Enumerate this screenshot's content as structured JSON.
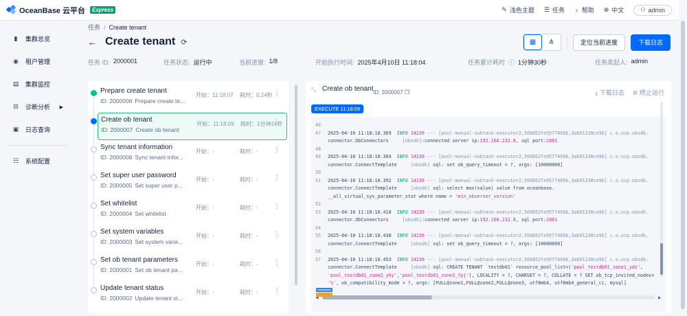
{
  "app": {
    "name": "OceanBase 云平台",
    "edition": "Express"
  },
  "topbar": {
    "items": [
      {
        "icon": "paint-brush-icon",
        "label": "浅色主题"
      },
      {
        "icon": "list-icon",
        "label": "任务"
      },
      {
        "icon": "lightbulb-icon",
        "label": "帮助"
      },
      {
        "icon": "globe-icon",
        "label": "中文"
      }
    ],
    "user": "admin"
  },
  "sidebar": {
    "items": [
      {
        "icon": "bar-chart-icon",
        "label": "集群总览"
      },
      {
        "icon": "tenant-icon",
        "label": "租户管理"
      },
      {
        "icon": "monitor-icon",
        "label": "集群监控"
      },
      {
        "icon": "diagnosis-icon",
        "label": "诊断分析",
        "has_submenu": true
      },
      {
        "icon": "log-icon",
        "label": "日志查询"
      }
    ],
    "bottom_items": [
      {
        "icon": "sliders-icon",
        "label": "系统配置"
      }
    ]
  },
  "breadcrumb": {
    "parent": "任务",
    "current": "Create tenant"
  },
  "page": {
    "title": "Create tenant"
  },
  "actions": {
    "locate": "定位当前进度",
    "download": "下载日志"
  },
  "meta": {
    "task_id_label": "任务 ID:",
    "task_id": "2000001",
    "status_label": "任务状态:",
    "status": "运行中",
    "progress_label": "当前进度:",
    "progress": "1/8",
    "start_label": "开始执行时间:",
    "start": "2025年4月10日 11:18:04",
    "elapsed_label": "任务累计耗时",
    "elapsed": "1分钟30秒",
    "initiator_label": "任务发起人:",
    "initiator": "admin"
  },
  "tasks": [
    {
      "name": "Prepare create tenant",
      "id": "ID: 2000006",
      "desc": "Prepare create te...",
      "start": "开始：11:18:07",
      "cost": "耗时：0.24秒",
      "state": "done"
    },
    {
      "name": "Create ob tenant",
      "id": "ID: 2000007",
      "desc": "Create ob tenant",
      "start": "开始：11:18:09",
      "cost": "耗时：1分钟24秒",
      "state": "running"
    },
    {
      "name": "Sync tenant information",
      "id": "ID: 2000008",
      "desc": "Sync tenant infor...",
      "start": "开始：-",
      "cost": "耗时：-",
      "state": "pending"
    },
    {
      "name": "Set super user password",
      "id": "ID: 2000005",
      "desc": "Set super user p...",
      "start": "开始：-",
      "cost": "耗时：-",
      "state": "pending"
    },
    {
      "name": "Set whitelist",
      "id": "ID: 2000004",
      "desc": "Set whitelist",
      "start": "开始：-",
      "cost": "耗时：-",
      "state": "pending"
    },
    {
      "name": "Set system variables",
      "id": "ID: 2000003",
      "desc": "Set system varia...",
      "start": "开始：-",
      "cost": "耗时：-",
      "state": "pending"
    },
    {
      "name": "Set ob tenant parameters",
      "id": "ID: 2000001",
      "desc": "Set ob tenant pa...",
      "start": "开始：-",
      "cost": "耗时：-",
      "state": "pending"
    },
    {
      "name": "Update tenant status",
      "id": "ID: 2000002",
      "desc": "Update tenant st...",
      "start": "开始：-",
      "cost": "耗时：-",
      "state": "pending"
    }
  ],
  "detail": {
    "title": "Create ob tenant",
    "id": "ID: 2000007",
    "download": "下载日志",
    "stop": "终止运行",
    "execute_badge": "EXECUTE 11:18:09"
  },
  "log": [
    {
      "n": "46"
    },
    {
      "n": "47",
      "ts": "2025-04-10 11:18:10.369",
      "lvl": "INFO",
      "pid": "14236",
      "thr": "--- [pool-manual-subtask-executor2,506852fe9577469b,3ab91238ce9b] c.o.ocp.obsdk.",
      "cls": "connector.ObConnectors",
      "tag": "[obsdk]",
      "msg": ":connected server ip:",
      "val": "192.168.232.8",
      "msg2": ", sql port:",
      "val2": "2881"
    },
    {
      "n": "48"
    },
    {
      "n": "49",
      "ts": "2025-04-10 11:18:10.384",
      "lvl": "INFO",
      "pid": "14236",
      "thr": "--- [pool-manual-subtask-executor2,506852fe9577469b,3ab91238ce9b] c.o.ocp.obsdk.",
      "cls": "connector.ConnectTemplate",
      "tag": "[obsdk]",
      "msg": " sql: set ob_query_timeout = ?, args: [10000000]"
    },
    {
      "n": "50"
    },
    {
      "n": "51",
      "ts": "2025-04-10 11:18:10.392",
      "lvl": "INFO",
      "pid": "14236",
      "thr": "--- [pool-manual-subtask-executor2,506852fe9577469b,3ab91238ce9b] c.o.ocp.obsdk.",
      "cls": "connector.ConnectTemplate",
      "tag": "[obsdk]",
      "msg": " sql: select max(value) value from oceanbase.",
      "cont": "__all_virtual_sys_parameter_stat where name = ",
      "cont_str": "'min_observer_version'"
    },
    {
      "n": "52"
    },
    {
      "n": "53",
      "ts": "2025-04-10 11:18:10.418",
      "lvl": "INFO",
      "pid": "14236",
      "thr": "--- [pool-manual-subtask-executor2,506852fe9577469b,3ab91238ce9b] c.o.ocp.obsdk.",
      "cls": "connector.ObConnectors",
      "tag": "[obsdk]",
      "msg": ":connected server ip:",
      "val": "192.168.232.8",
      "msg2": ", sql port:",
      "val2": "2881"
    },
    {
      "n": "54"
    },
    {
      "n": "55",
      "ts": "2025-04-10 11:18:10.438",
      "lvl": "INFO",
      "pid": "14236",
      "thr": "--- [pool-manual-subtask-executor2,506852fe9577469b,3ab91238ce9b] c.o.ocp.obsdk.",
      "cls": "connector.ConnectTemplate",
      "tag": "[obsdk]",
      "msg": " sql: set ob_query_timeout = ?, args: [10000000]"
    },
    {
      "n": "56"
    },
    {
      "n": "57",
      "ts": "2025-04-10 11:18:10.453",
      "lvl": "INFO",
      "pid": "14236",
      "thr": "--- [pool-manual-subtask-executor2,506852fe9577469b,3ab91238ce9b] c.o.ocp.obsdk.",
      "cls": "connector.ConnectTemplate",
      "tag": "[obsdk]",
      "msg": " sql: CREATE TENANT `testdb01` resource_pool_list=(",
      "str1": "'pool_testdb01_zone1_ydz'",
      "msg3": ",",
      "line2_str": "'pool_testdb01_zone2_yhy','pool_testdb01_zone3_fpj'",
      "line2_rest": "), LOCALITY = ?, CHARSET = ?, COLLATE = ? SET ob_tcp_invited_nodes=",
      "line3_str": "'%'",
      "line3_rest": ", ob_compatibility_mode = ?, args: [FULL@zone1,FULL@zone2,FULL@zone3, utf8mb4, utf8mb4_general_ci, mysql]"
    }
  ],
  "colors": {
    "primary": "#006aff",
    "success": "#0ac185",
    "info_level": "#0a9f6e",
    "pid": "#c0359b"
  }
}
